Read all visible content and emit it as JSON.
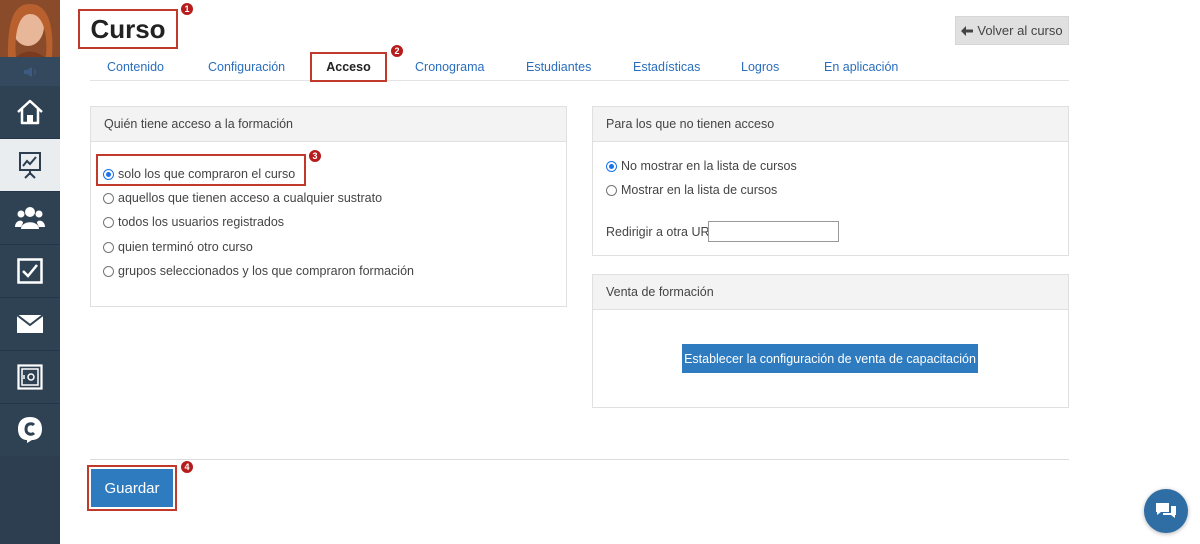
{
  "header": {
    "title": "Curso",
    "back_button": "Volver al curso"
  },
  "badges": [
    "1",
    "2",
    "3",
    "4"
  ],
  "tabs": [
    {
      "label": "Contenido"
    },
    {
      "label": "Configuración"
    },
    {
      "label": "Acceso"
    },
    {
      "label": "Cronograma"
    },
    {
      "label": "Estudiantes"
    },
    {
      "label": "Estadísticas"
    },
    {
      "label": "Logros"
    },
    {
      "label": "En aplicación"
    }
  ],
  "access_panel": {
    "title": "Quién tiene acceso a la formación",
    "options": [
      {
        "label": "solo los que compraron el curso",
        "checked": true
      },
      {
        "label": "aquellos que tienen acceso a cualquier sustrato",
        "checked": false
      },
      {
        "label": "todos los usuarios registrados",
        "checked": false
      },
      {
        "label": "quien terminó otro curso",
        "checked": false
      },
      {
        "label": "grupos seleccionados y los que compraron formación",
        "checked": false
      }
    ]
  },
  "no_access_panel": {
    "title": "Para los que no tienen acceso",
    "options": [
      {
        "label": "No mostrar en la lista de cursos",
        "checked": true
      },
      {
        "label": "Mostrar en la lista de cursos",
        "checked": false
      }
    ],
    "redirect_label": "Redirigir a otra URL",
    "redirect_value": ""
  },
  "sale_panel": {
    "title": "Venta de formación",
    "button": "Establecer la configuración de venta de capacitación"
  },
  "save_button": "Guardar",
  "sidebar": {
    "items": [
      {
        "icon": "home-icon"
      },
      {
        "icon": "presentation-chart-icon",
        "active": true
      },
      {
        "icon": "users-icon"
      },
      {
        "icon": "checkbox-icon"
      },
      {
        "icon": "mail-icon"
      },
      {
        "icon": "safe-icon"
      },
      {
        "icon": "c-logo-icon"
      }
    ]
  },
  "colors": {
    "sidebar": "#2c3e50",
    "accent": "#2f7bbf",
    "highlight": "#c0392b",
    "link": "#2a6ebd"
  }
}
